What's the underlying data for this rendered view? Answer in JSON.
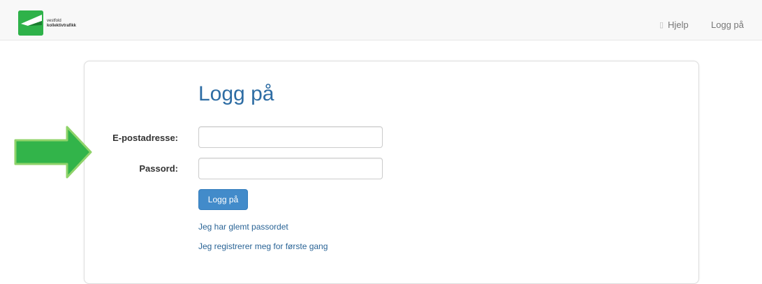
{
  "header": {
    "logo_line1": "vestfold",
    "logo_line2": "kollektivtrafikk",
    "help_label": "Hjelp",
    "login_label": "Logg på",
    "help_icon": "help-icon",
    "logo_icon": "vkt-logo-icon"
  },
  "main": {
    "title": "Logg på",
    "email_label": "E-postadresse:",
    "email_value": "",
    "password_label": "Passord:",
    "password_value": "",
    "submit_label": "Logg på",
    "forgot_link": "Jeg har glemt passordet",
    "register_link": "Jeg registrerer meg for første gang"
  },
  "annotation": {
    "arrow_icon": "right-arrow-icon"
  },
  "colors": {
    "brand_green": "#2fb24a",
    "arrow_green": "#32b44a",
    "primary_button": "#428bca",
    "title_blue": "#2e6da4",
    "link_blue": "#2a6496"
  }
}
